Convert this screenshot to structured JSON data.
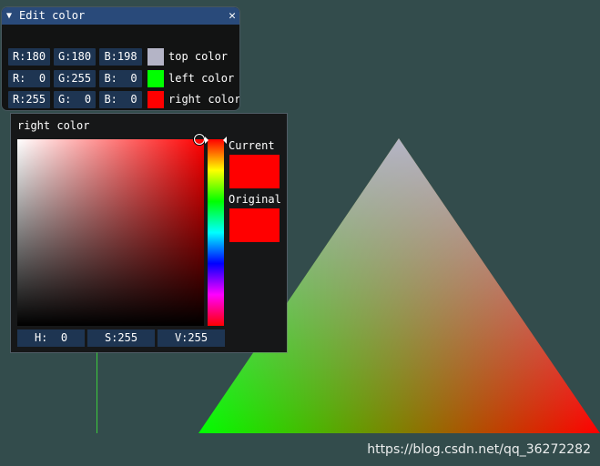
{
  "window": {
    "title": "Edit color",
    "collapse_icon": "▼",
    "close_icon": "✕",
    "rows": [
      {
        "r": "R:180",
        "g": "G:180",
        "b": "B:198",
        "swatch": "#b4b4c6",
        "label": "top color"
      },
      {
        "r": "R:  0",
        "g": "G:255",
        "b": "B:  0",
        "swatch": "#00ff00",
        "label": "left color"
      },
      {
        "r": "R:255",
        "g": "G:  0",
        "b": "B:  0",
        "swatch": "#ff0000",
        "label": "right color"
      }
    ]
  },
  "picker": {
    "title": "right color",
    "current_label": "Current",
    "original_label": "Original",
    "current_color": "#ff0000",
    "original_color": "#ff0000",
    "h": "H:  0",
    "s": "S:255",
    "v": "V:255"
  },
  "triangle": {
    "top_color": "#b4b4c6",
    "left_color": "#00ff00",
    "right_color": "#ff0000"
  },
  "watermark": "https://blog.csdn.net/qq_36272282"
}
